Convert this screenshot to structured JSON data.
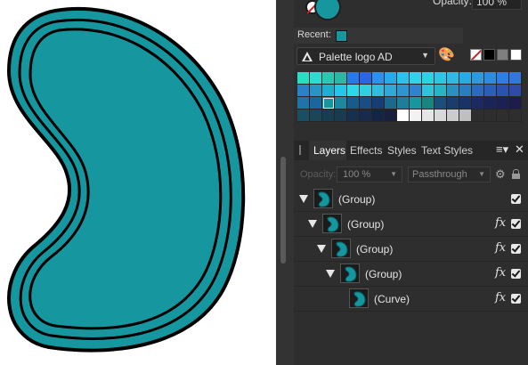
{
  "colors": {
    "teal": "#16979f",
    "panel_bg": "#2e2e2e"
  },
  "color_panel": {
    "opacity_label": "Opacity:",
    "opacity_value": "100 %",
    "recent_label": "Recent:",
    "palette_name": "Palette logo AD",
    "palette_icon": "affinity-designer-icon",
    "palette_menu_icon": "palette-icon",
    "grid": [
      [
        "#27e0c4",
        "#2cdccf",
        "#2bc8b0",
        "#32b6a4",
        "#2b78e8",
        "#2d66e0",
        "#2c90ec",
        "#27a9ec",
        "#2fc0ec",
        "#30d2ec",
        "#2ad4e8",
        "#2ec6e6",
        "#33b8e4",
        "#2aaae2",
        "#2d9ae0",
        "#2e8cdc",
        "#2d7ee0",
        "#3476dc"
      ],
      [
        "#2a82c6",
        "#2a95c4",
        "#1eb0d0",
        "#22c7ea",
        "#2cd9ec",
        "#30d0e2",
        "#30bde0",
        "#30a8d8",
        "#3094d2",
        "#3082cc",
        "#2fc4dc",
        "#24b6c8",
        "#2a90c0",
        "#2a7ec0",
        "#2a6ac0",
        "#2a5eb8",
        "#2c52b0",
        "#2f4aa8"
      ],
      [
        "#1e73a8",
        "#1a67a0",
        "#16979f",
        "#1b88a0",
        "#175b8a",
        "#1a4e82",
        "#163e74",
        "#1a6a8e",
        "#1c7f9a",
        "#16979f",
        "#18857e",
        "#1b4e7a",
        "#1a3d6c",
        "#193368",
        "#1b2a60",
        "#1b2458",
        "#1c2052",
        "#1d1c4c"
      ],
      [
        "#1a4e60",
        "#1a4658",
        "#173e50",
        "#1a3a50",
        "#17304c",
        "#1a2a4a",
        "#162446",
        "#18203c",
        "#ffffff",
        "#f2f2f2",
        "#e6e6e6",
        "#d9d9d9",
        "#cccccc",
        "#bfbfbf",
        "#2e2e2e",
        "#2e2e2e",
        "#2e2e2e",
        "#2e2e2e"
      ]
    ]
  },
  "layers_panel": {
    "tabs": [
      "Layers",
      "Effects",
      "Styles",
      "Text Styles"
    ],
    "menu_icon": "menu-icon",
    "close_icon": "close-icon",
    "toolbar": {
      "opacity_label": "Opacity:",
      "opacity_value": "100 %",
      "blend_mode": "Passthrough"
    },
    "layers": [
      {
        "name": "(Group)",
        "indent": 0,
        "fx": false
      },
      {
        "name": "(Group)",
        "indent": 1,
        "fx": true
      },
      {
        "name": "(Group)",
        "indent": 2,
        "fx": true
      },
      {
        "name": "(Group)",
        "indent": 3,
        "fx": true
      },
      {
        "name": "(Curve)",
        "indent": 4,
        "fx": true
      }
    ]
  }
}
